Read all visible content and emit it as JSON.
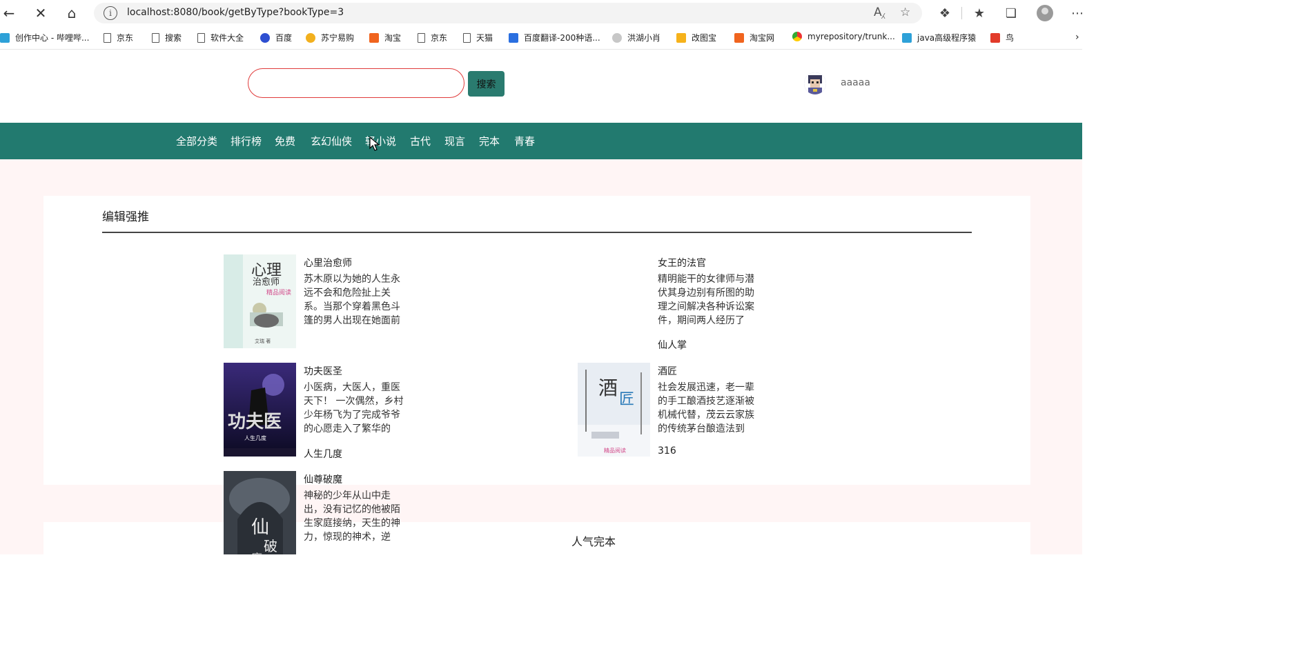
{
  "browser": {
    "url": "localhost:8080/book/getByType?bookType=3",
    "bookmarks": [
      "创作中心 - 哔哩哔...",
      "京东",
      "搜索",
      "软件大全",
      "百度",
      "苏宁易购",
      "淘宝",
      "京东",
      "天猫",
      "百度翻译-200种语...",
      "洪湖小肖",
      "改图宝",
      "淘宝网",
      "myrepository/trunk...",
      "java高级程序猿",
      "鸟"
    ]
  },
  "header": {
    "search_placeholder": "",
    "search_button": "搜索",
    "username": "aaaaa"
  },
  "nav": [
    "全部分类",
    "排行榜",
    "免费",
    "玄幻仙侠",
    "轻小说",
    "古代",
    "现言",
    "完本",
    "青春"
  ],
  "sections": {
    "recommend_title": "编辑强推",
    "popular_title": "人气完本"
  },
  "books": [
    {
      "title": "心里治愈师",
      "desc": "苏木原以为她的人生永远不会和危险扯上关系。当那个穿着黑色斗篷的男人出现在她面前",
      "author": ""
    },
    {
      "title": "女王的法官",
      "desc": "精明能干的女律师与潜伏其身边别有所图的助理之间解决各种诉讼案件，期间两人经历了",
      "author": "仙人掌"
    },
    {
      "title": "功夫医圣",
      "desc": "小医病，大医人，重医天下！ 一次偶然，乡村少年杨飞为了完成爷爷的心愿走入了繁华的",
      "author": "人生几度"
    },
    {
      "title": "酒匠",
      "desc": "社会发展迅速，老一辈的手工酿酒技艺逐渐被机械代替，茂云云家族的传统茅台酿造法到",
      "author": "316"
    },
    {
      "title": "仙尊破魔",
      "desc": "神秘的少年从山中走出，没有记忆的他被陌生家庭接纳，天生的神力，惊现的神术，逆",
      "author": ""
    }
  ]
}
